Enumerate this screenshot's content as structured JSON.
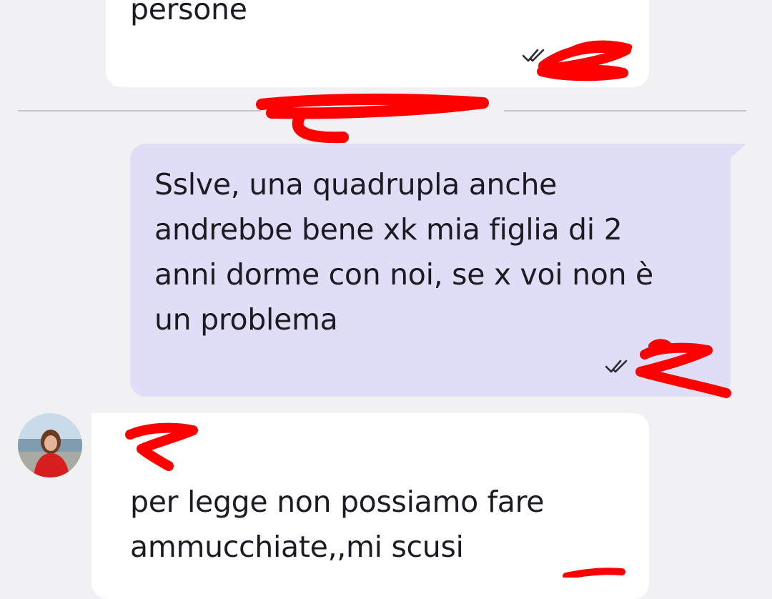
{
  "messages": {
    "top_incoming": {
      "text": "persone",
      "time": "",
      "status_icon": "double-check-icon"
    },
    "date_separator": {
      "label": ""
    },
    "outgoing": {
      "text": "Sslve, una quadrupla anche\nandrebbe bene xk mia figlia di 2\nanni dorme con noi, se x voi non è\nun problema",
      "time": "",
      "status_icon": "double-check-icon"
    },
    "bottom_incoming": {
      "sender_name": "",
      "text": "per legge non possiamo fare\nammucchiate,,mi scusi",
      "avatar_icon": "avatar"
    }
  },
  "colors": {
    "background": "#f1f1f4",
    "incoming_bubble": "#ffffff",
    "outgoing_bubble": "#e0ddf7",
    "redaction": "#ff0000",
    "text": "#1c1b22"
  }
}
